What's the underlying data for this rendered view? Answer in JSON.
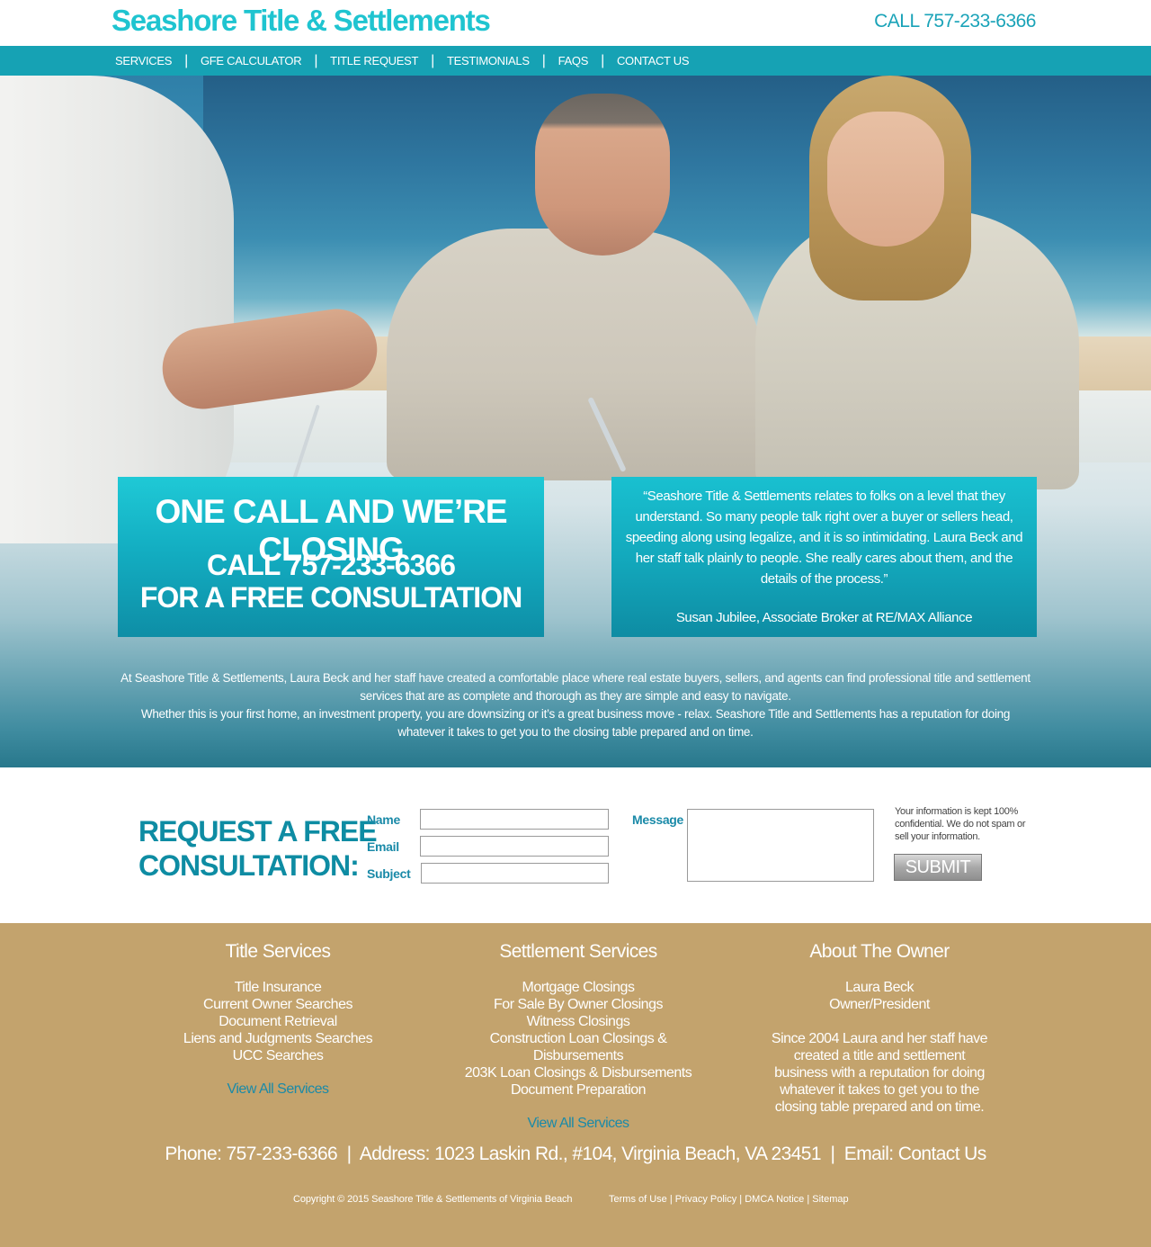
{
  "header": {
    "logo": "Seashore Title & Settlements",
    "phone": "CALL 757-233-6366"
  },
  "nav": {
    "items": [
      "SERVICES",
      "GFE CALCULATOR",
      "TITLE REQUEST",
      "TESTIMONIALS",
      "FAQS",
      "CONTACT US"
    ],
    "separator": "|"
  },
  "hero": {
    "cta_title": "ONE CALL AND WE’RE CLOSING",
    "cta_call": "CALL  757-233-6366",
    "cta_free": "FOR A FREE CONSULTATION",
    "quote": "“Seashore Title & Settlements relates to folks on a level that they understand. So many people talk right over a buyer or sellers head, speeding along using legalize, and it is so intimidating. Laura Beck and her staff talk plainly to people. She really cares about them, and the details of the process.”",
    "quote_author": "Susan Jubilee, Associate Broker at RE/MAX Alliance",
    "intro_1": "At Seashore Title & Settlements, Laura Beck and her staff have created a comfortable place where real estate buyers, sellers, and agents can find professional title and settlement services that are as complete and thorough as they are simple and easy to navigate.",
    "intro_2": "Whether this is your first home, an investment property, you are downsizing or it’s a great business move - relax. Seashore Title and Settlements has a reputation for doing whatever it takes to get you to the closing table prepared and on time."
  },
  "form": {
    "title_line1": "REQUEST A FREE",
    "title_line2": "CONSULTATION:",
    "name_label": "Name",
    "email_label": "Email",
    "subject_label": "Subject",
    "message_label": "Message",
    "name_value": "",
    "email_value": "",
    "subject_value": "",
    "message_value": "",
    "note": "Your information is kept 100% confidential. We do not spam or sell your information.",
    "submit": "SUBMIT"
  },
  "footer": {
    "title_services": {
      "heading": "Title Services",
      "items": [
        "Title Insurance",
        "Current Owner Searches",
        "Document Retrieval",
        "Liens and Judgments Searches",
        "UCC Searches"
      ],
      "view_all": "View All Services"
    },
    "settlement_services": {
      "heading": "Settlement Services",
      "items": [
        "Mortgage Closings",
        "For Sale By Owner Closings",
        "Witness Closings",
        "Construction Loan Closings & Disbursements",
        "203K Loan Closings & Disbursements",
        "Document Preparation"
      ],
      "view_all": "View All Services"
    },
    "about": {
      "heading": "About The Owner",
      "name": "Laura Beck",
      "title": "Owner/President",
      "bio": "Since 2004 Laura and her staff have created a title and settlement business with a reputation for doing whatever it takes to get you to the closing table prepared and on time."
    },
    "contact": {
      "phone": "Phone: 757-233-6366",
      "address": "Address: 1023 Laskin Rd., #104,  Virginia Beach, VA 23451",
      "email_prefix": "Email: ",
      "email_link": "Contact Us",
      "separator": "|"
    },
    "copyright": "Copyright © 2015 Seashore Title & Settlements of Virginia Beach",
    "legal": [
      "Terms of Use",
      "Privacy Policy",
      "DMCA Notice",
      "Sitemap"
    ]
  },
  "colors": {
    "accent": "#16a2b4",
    "logo": "#1fc4d0",
    "footer_bg": "#c3a36d",
    "link": "#1a8aa8"
  }
}
